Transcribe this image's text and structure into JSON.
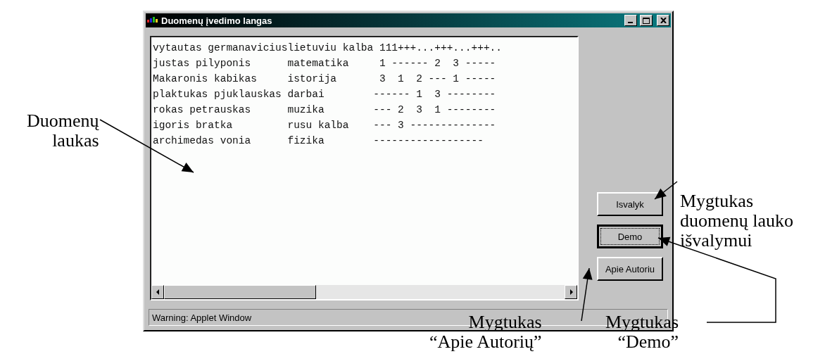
{
  "window": {
    "title": "Duomenų įvedimo langas"
  },
  "data_field": {
    "lines": [
      "vytautas germanaviciuslietuviu kalba 111+++...+++...+++..",
      "justas pilyponis      matematika     1 ------ 2  3 -----",
      "Makaronis kabikas     istorija       3  1  2 --- 1 -----",
      "plaktukas pjuklauskas darbai        ------ 1  3 --------",
      "rokas petrauskas      muzika        --- 2  3  1 --------",
      "igoris bratka         rusu kalba    --- 3 --------------",
      "archimedas vonia      fizika        ------------------"
    ]
  },
  "buttons": [
    {
      "label": "Isvalyk",
      "focused": false
    },
    {
      "label": "Demo",
      "focused": true
    },
    {
      "label": "Apie Autoriu",
      "focused": false
    }
  ],
  "status_bar": "Warning: Applet Window",
  "annotations": [
    {
      "lines": [
        "Duomenų",
        "laukas"
      ]
    },
    {
      "lines": [
        "Mygtukas",
        "duomenų lauko",
        "išvalymui"
      ]
    },
    {
      "lines": [
        "Mygtukas",
        "“Apie Autorių”"
      ]
    },
    {
      "lines": [
        "Mygtukas",
        "“Demo”"
      ]
    }
  ]
}
